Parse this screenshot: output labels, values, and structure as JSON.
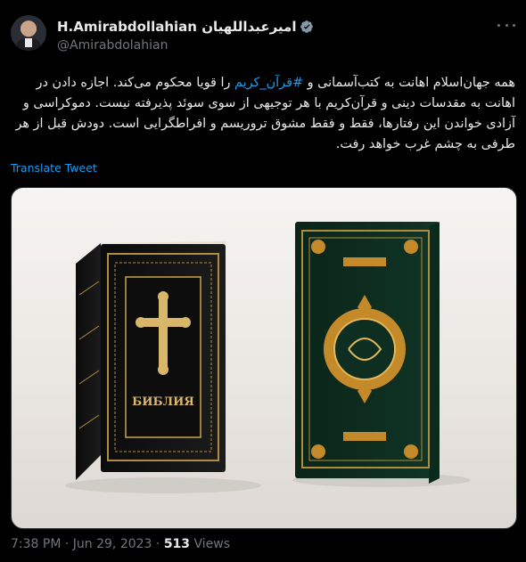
{
  "author": {
    "display_name": "H.Amirabdollahian امیرعبداللهیان",
    "handle": "@Amirabdolahian"
  },
  "tweet": {
    "text_before": "همه جهان‌اسلام اهانت به کتب‌آسمانی و ",
    "hashtag": "#قرآن_کریم",
    "text_after": " را قویا محکوم می‌کند. اجازه دادن در اهانت به مقدسات دینی و قرآن‌کریم با هر توجیهی از سوی سوئد پذیرفته نیست. دموکراسی و آزادی خواندن این رفتارها، فقط و فقط مشوق تروریسم و افراطگرایی است. دودش قبل از هر طرفی به چشم غرب خواهد رفت.",
    "translate_label": "Translate Tweet"
  },
  "media": {
    "left_book_title": "БИБЛИЯ"
  },
  "footer": {
    "time": "7:38 PM",
    "separator": " · ",
    "date": "Jun 29, 2023",
    "views_count": "513",
    "views_label": " Views"
  },
  "colors": {
    "background": "#000000",
    "text": "#e7e9ea",
    "muted": "#71767b",
    "link": "#1d9bf0"
  },
  "icons": [
    "verified-badge-icon",
    "more-options-icon"
  ]
}
